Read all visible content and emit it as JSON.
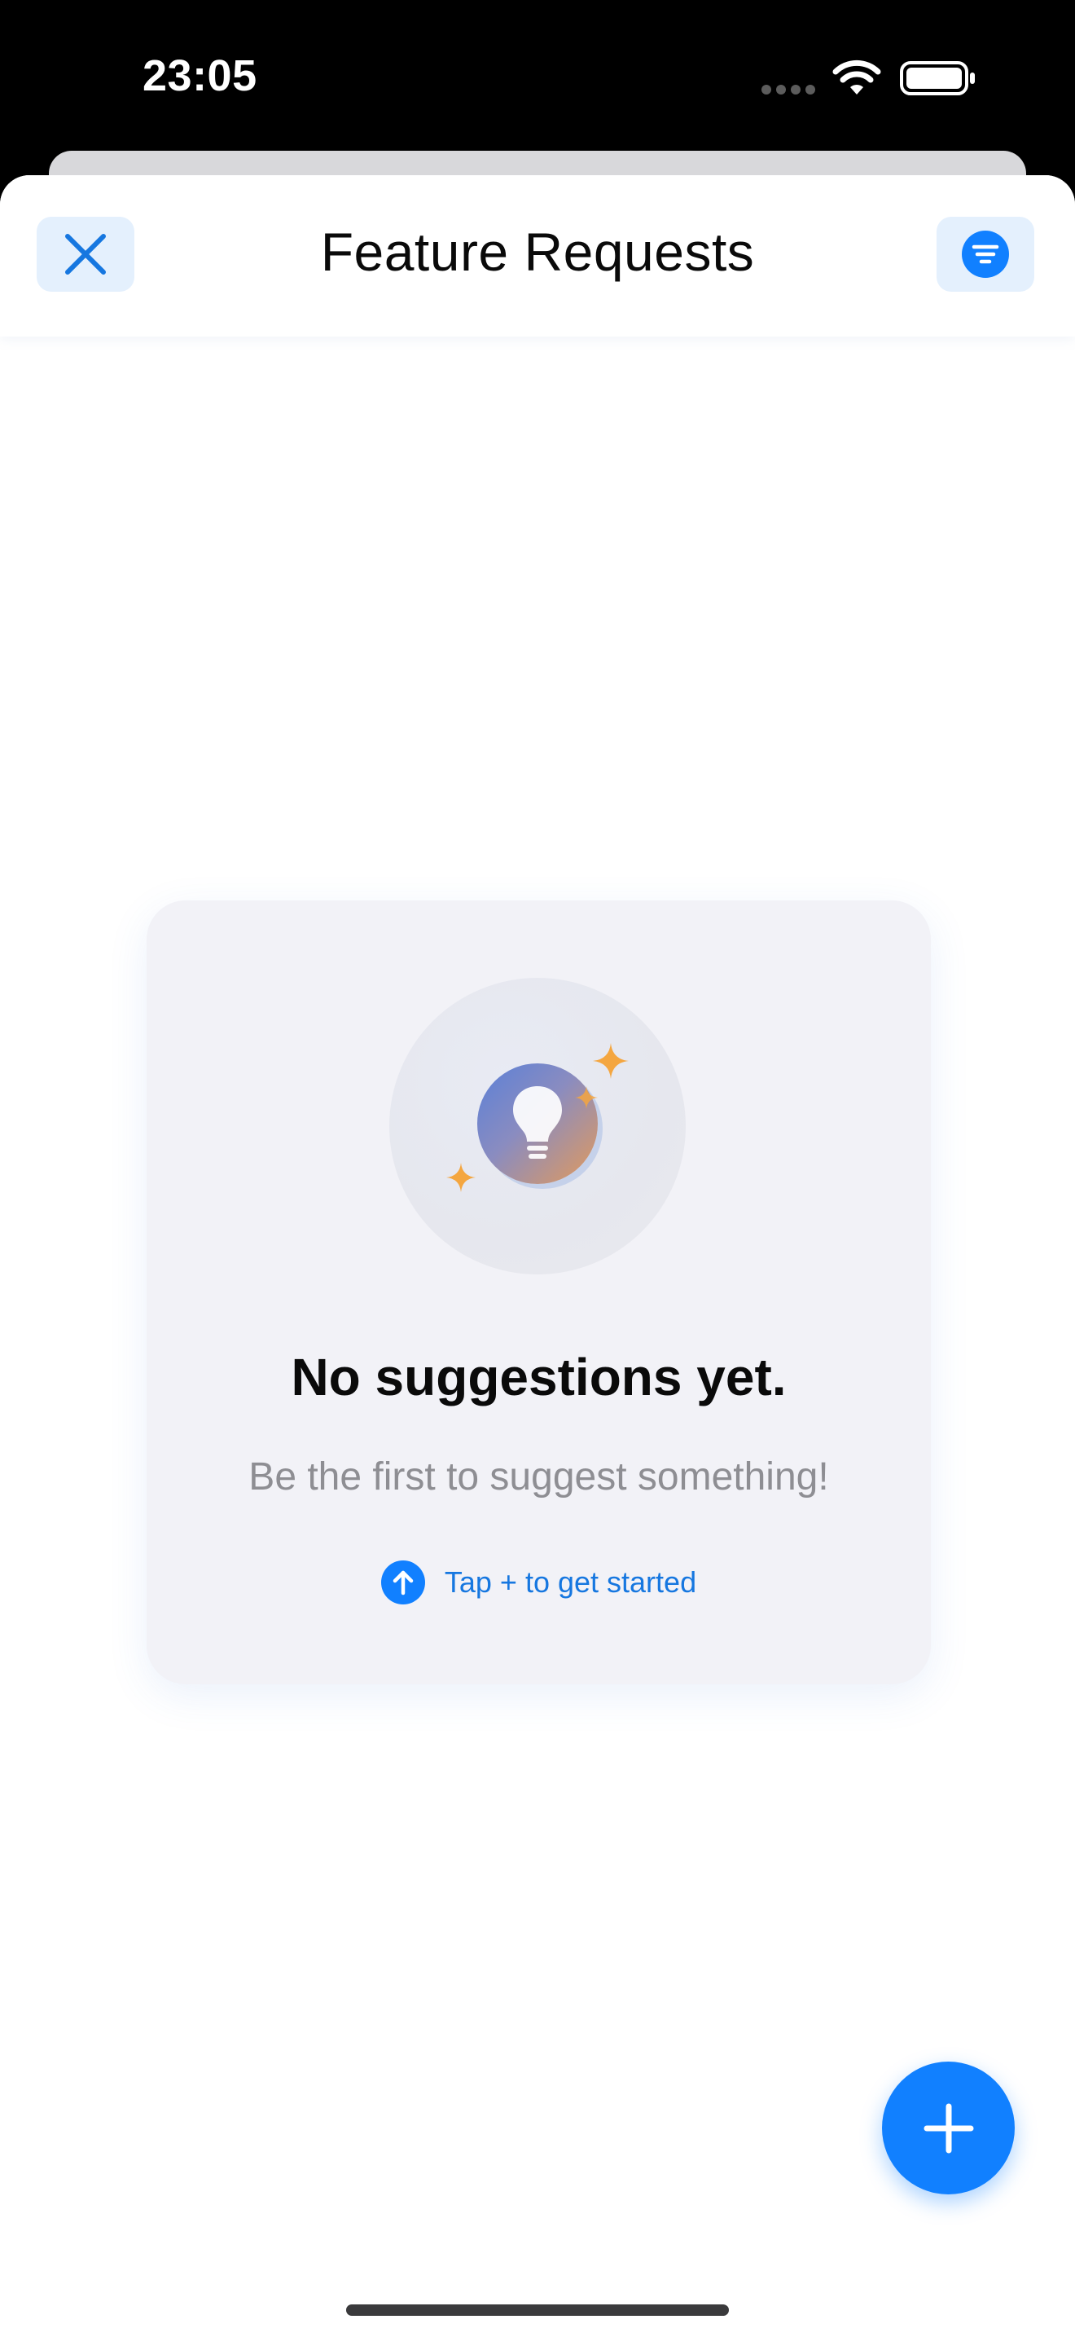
{
  "status_bar": {
    "time": "23:05",
    "icons": [
      "cellular-signal-icon",
      "wifi-icon",
      "battery-icon"
    ]
  },
  "nav": {
    "title": "Feature Requests",
    "close_icon": "close-icon",
    "filter_icon": "filter-icon"
  },
  "empty_state": {
    "illustration_icon": "lightbulb-icon",
    "title": "No suggestions yet.",
    "subtitle": "Be the first to suggest something!",
    "hint": "Tap + to get started",
    "hint_icon": "arrow-up-circle-icon"
  },
  "fab": {
    "icon": "plus-icon"
  },
  "colors": {
    "accent": "#1180FF",
    "button_tint": "#E4F0FD",
    "card_background": "#F2F2F7",
    "secondary_text": "#8E8E93",
    "hint_text": "#1677E0",
    "sparkle": "#F4A640"
  }
}
